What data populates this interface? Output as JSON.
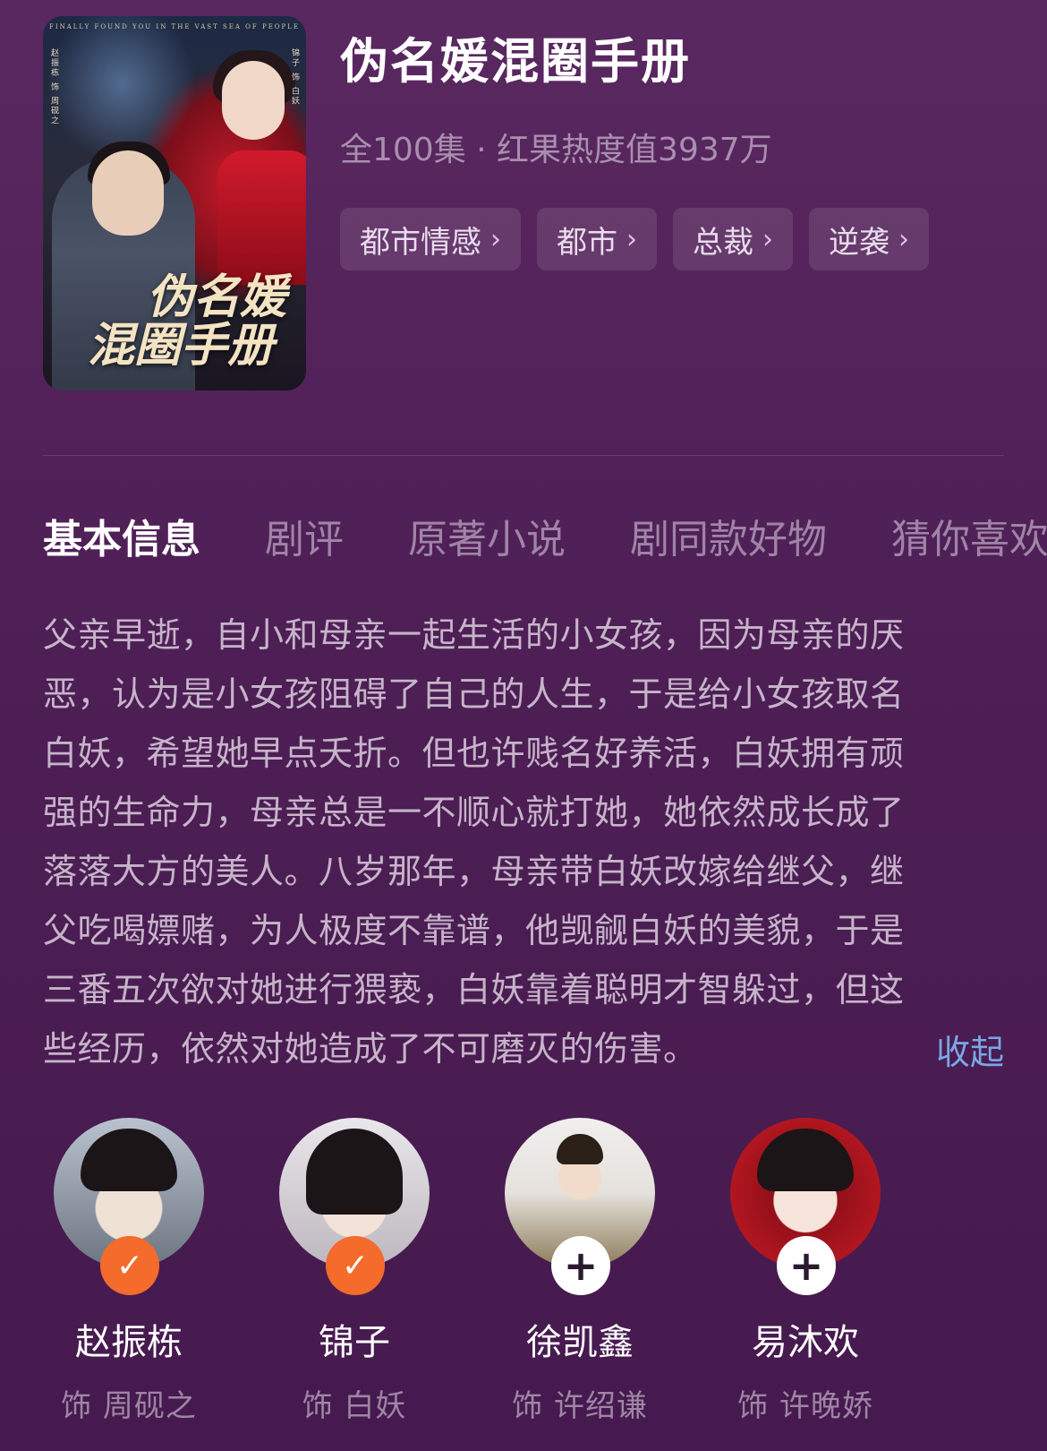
{
  "poster": {
    "tagline": "FINALLY FOUND YOU IN THE VAST SEA OF PEOPLE",
    "title_line1": "伪名媛",
    "title_line2": "混圈手册",
    "left_credit": "赵振栋 饰 周砚之",
    "right_credit": "锦子 饰 白妖"
  },
  "drama": {
    "title": "伪名媛混圈手册",
    "meta": "全100集 · 红果热度值3937万",
    "tags": [
      "都市情感",
      "都市",
      "总裁",
      "逆袭"
    ]
  },
  "tabs": [
    "基本信息",
    "剧评",
    "原著小说",
    "剧同款好物",
    "猜你喜欢"
  ],
  "active_tab": 0,
  "synopsis": {
    "lines": [
      "父亲早逝，自小和母亲一起生活的小女孩，因为母亲的厌",
      "恶，认为是小女孩阻碍了自己的人生，于是给小女孩取名",
      "白妖，希望她早点夭折。但也许贱名好养活，白妖拥有顽",
      "强的生命力，母亲总是一不顺心就打她，她依然成长成了",
      "落落大方的美人。八岁那年，母亲带白妖改嫁给继父，继",
      "父吃喝嫖赌，为人极度不靠谱，他觊觎白妖的美貌，于是",
      "三番五次欲对她进行猥亵，白妖靠着聪明才智躲过，但这",
      "些经历，依然对她造成了不可磨灭的伤害。"
    ],
    "collapse_label": "收起"
  },
  "cast": [
    {
      "name": "赵振栋",
      "role": "饰 周砚之",
      "status": "followed",
      "icon": "check-icon"
    },
    {
      "name": "锦子",
      "role": "饰 白妖",
      "status": "followed",
      "icon": "check-icon"
    },
    {
      "name": "徐凯鑫",
      "role": "饰 许绍谦",
      "status": "not-followed",
      "icon": "plus-icon"
    },
    {
      "name": "易沐欢",
      "role": "饰 许晚娇",
      "status": "not-followed",
      "icon": "plus-icon"
    }
  ],
  "colors": {
    "background": "#4d1f55",
    "follow_badge": "#f46b2c",
    "link": "#7aa6e6",
    "muted_text": "#a98faf"
  }
}
